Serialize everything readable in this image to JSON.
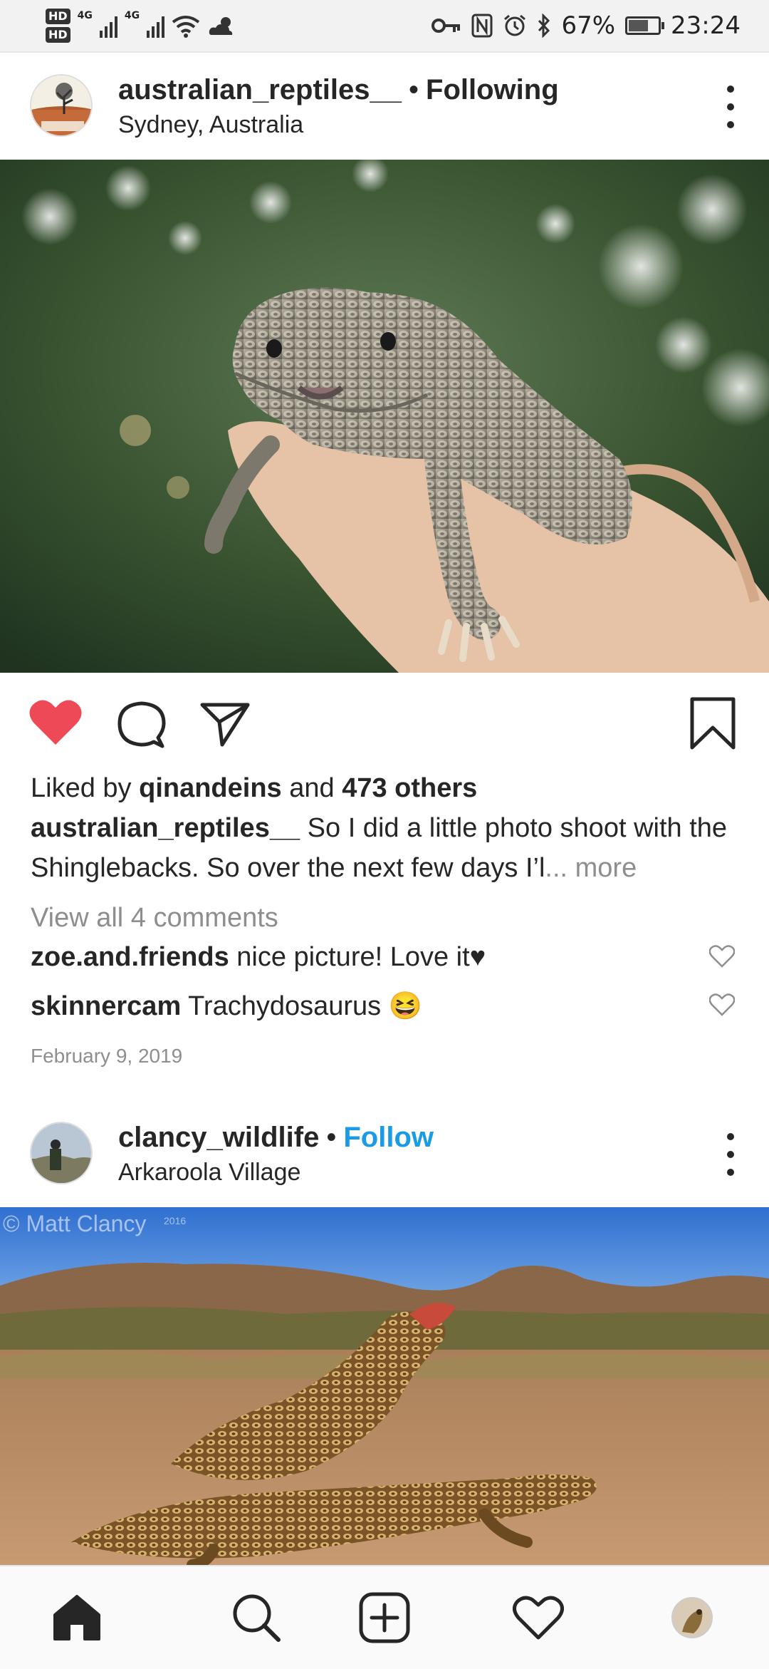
{
  "status_bar": {
    "hd1": "HD",
    "hd2": "HD",
    "net1": "4G",
    "net2": "4G",
    "battery": "67%",
    "battery_level": 0.67,
    "time": "23:24"
  },
  "post1": {
    "username": "australian_reptiles__",
    "dot": "•",
    "follow_state": "Following",
    "location": "Sydney, Australia",
    "liked_prefix": "Liked by",
    "liked_user": "qinandeins",
    "liked_and": "and",
    "liked_count": "473 others",
    "caption_user": "australian_reptiles__",
    "caption_text": "So I did a little photo shoot with the Shinglebacks. So over the next few days I’l",
    "caption_more": "... more",
    "view_comments": "View all 4 comments",
    "comments": [
      {
        "user": "zoe.and.friends",
        "text": "nice picture! Love it♥"
      },
      {
        "user": "skinnercam",
        "text": "Trachydosaurus 😆"
      }
    ],
    "date": "February 9, 2019"
  },
  "post2": {
    "username": "clancy_wildlife",
    "dot": "•",
    "follow_state": "Follow",
    "location": "Arkaroola Village",
    "watermark": "© Matt Clancy",
    "watermark_year": "2016"
  },
  "icons": {
    "like": "heart-filled-icon",
    "comment": "comment-icon",
    "share": "share-icon",
    "save": "bookmark-icon",
    "nav": [
      "home-icon",
      "search-icon",
      "add-post-icon",
      "activity-icon",
      "profile-avatar"
    ]
  },
  "colors": {
    "like_red": "#ed4956",
    "follow_blue": "#1a9be6",
    "muted_gray": "#8e8e8e"
  }
}
